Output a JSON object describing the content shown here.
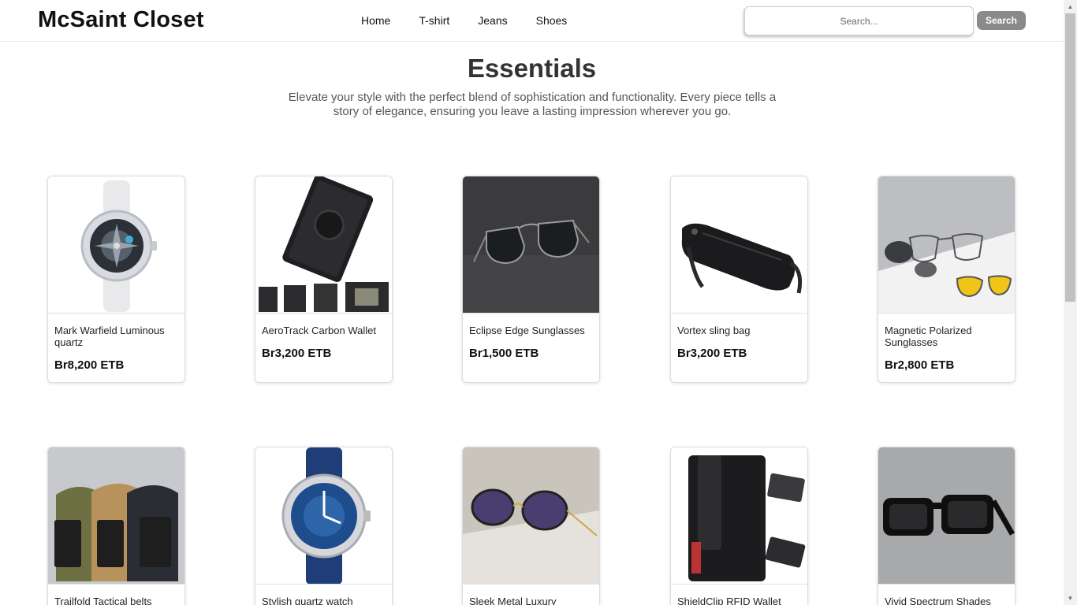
{
  "header": {
    "brand": "McSaint Closet",
    "nav": [
      "Home",
      "T-shirt",
      "Jeans",
      "Shoes"
    ],
    "search_placeholder": "Search...",
    "search_button": "Search"
  },
  "hero": {
    "title": "Essentials",
    "description": "Elevate your style with the perfect blend of sophistication and functionality. Every piece tells a story of elegance, ensuring you leave a lasting impression wherever you go."
  },
  "products": [
    {
      "name": "Mark Warfield Luminous quartz",
      "price": "Br8,200 ETB",
      "icon": "watch-white-icon"
    },
    {
      "name": "AeroTrack Carbon Wallet",
      "price": "Br3,200 ETB",
      "icon": "carbon-wallet-icon"
    },
    {
      "name": "Eclipse Edge Sunglasses",
      "price": "Br1,500 ETB",
      "icon": "sunglasses-icon"
    },
    {
      "name": "Vortex sling bag",
      "price": "Br3,200 ETB",
      "icon": "sling-bag-icon"
    },
    {
      "name": "Magnetic Polarized Sunglasses",
      "price": "Br2,800 ETB",
      "icon": "clip-on-glasses-icon"
    },
    {
      "name": "Trailfold Tactical belts",
      "price": "",
      "icon": "belts-icon"
    },
    {
      "name": "Stylish quartz watch",
      "price": "",
      "icon": "watch-blue-icon"
    },
    {
      "name": "Sleek Metal Luxury",
      "price": "",
      "icon": "round-sunglasses-icon"
    },
    {
      "name": "ShieldClip RFID Wallet",
      "price": "",
      "icon": "rfid-wallet-icon"
    },
    {
      "name": "Vivid Spectrum Shades",
      "price": "",
      "icon": "square-sunglasses-icon"
    }
  ]
}
